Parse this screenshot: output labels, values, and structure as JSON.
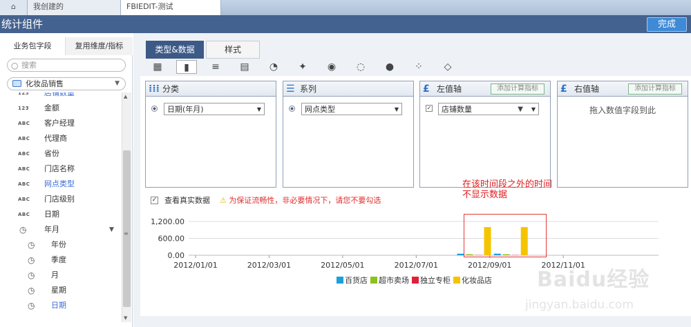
{
  "tabs": {
    "tab1": "我创建的",
    "tab2": "FBIEDIT-测试"
  },
  "title": "统计组件",
  "done_label": "完成",
  "left": {
    "tabs": [
      "业务包字段",
      "复用维度/指标"
    ],
    "search_placeholder": "搜索",
    "package": "化妆品销售",
    "fields": [
      {
        "type": "123",
        "name": "店铺数量",
        "highlight": true
      },
      {
        "type": "123",
        "name": "金额"
      },
      {
        "type": "ABC",
        "name": "客户经理"
      },
      {
        "type": "ABC",
        "name": "代理商"
      },
      {
        "type": "ABC",
        "name": "省份"
      },
      {
        "type": "ABC",
        "name": "门店名称"
      },
      {
        "type": "ABC",
        "name": "网点类型",
        "highlight": true
      },
      {
        "type": "ABC",
        "name": "门店级别"
      },
      {
        "type": "ABC",
        "name": "日期"
      },
      {
        "type": "clock",
        "name": "年月",
        "expanded": true
      },
      {
        "type": "clock",
        "name": "年份",
        "child": true
      },
      {
        "type": "clock",
        "name": "季度",
        "child": true
      },
      {
        "type": "clock",
        "name": "月",
        "child": true
      },
      {
        "type": "clock",
        "name": "星期",
        "child": true
      },
      {
        "type": "clock",
        "name": "日期",
        "child": true,
        "highlight": true
      }
    ]
  },
  "content_tabs": [
    "类型&数据",
    "样式"
  ],
  "chart_types": [
    "table-icon",
    "bar-chart-icon",
    "bar-horizontal-icon",
    "stacked-bar-icon",
    "pie-icon",
    "map-icon",
    "gauge-icon",
    "donut-icon",
    "bubble-icon",
    "scatter-icon",
    "radar-icon"
  ],
  "zones": {
    "category": {
      "title": "分类",
      "item": "日期(年月)"
    },
    "series": {
      "title": "系列",
      "item": "网点类型"
    },
    "left_axis": {
      "title": "左值轴",
      "button": "添加计算指标",
      "item": "店铺数量"
    },
    "right_axis": {
      "title": "右值轴",
      "button": "添加计算指标",
      "hint": "拖入数值字段到此"
    }
  },
  "annotation": {
    "line1": "在该时间段之外的时间",
    "line2": "不显示数据"
  },
  "real_data_label": "查看真实数据",
  "warning": "为保证流畅性，非必要情况下，请您不要勾选",
  "colors": {
    "百货店": "#1a9fe0",
    "超市卖场": "#8cc219",
    "独立专柜": "#e0203a",
    "化妆品店": "#f5c400"
  },
  "chart_data": {
    "type": "bar",
    "categories": [
      "2012/01/01",
      "2012/03/01",
      "2012/05/01",
      "2012/07/01",
      "2012/09/01",
      "2012/11/01"
    ],
    "ylim": [
      0,
      1200
    ],
    "yticks": [
      "0.00",
      "600.00",
      "1,200.00"
    ],
    "series": [
      {
        "name": "百货店",
        "color": "#1a9fe0",
        "points": [
          {
            "x": "2012/08",
            "y": 55
          },
          {
            "x": "2012/09",
            "y": 55
          }
        ]
      },
      {
        "name": "超市卖场",
        "color": "#8cc219",
        "points": [
          {
            "x": "2012/08",
            "y": 35
          },
          {
            "x": "2012/09",
            "y": 35
          }
        ]
      },
      {
        "name": "独立专柜",
        "color": "#e0203a",
        "points": [
          {
            "x": "2012/08",
            "y": 8
          },
          {
            "x": "2012/09",
            "y": 8
          }
        ]
      },
      {
        "name": "化妆品店",
        "color": "#f5c400",
        "points": [
          {
            "x": "2012/08",
            "y": 1000
          },
          {
            "x": "2012/09",
            "y": 1000
          }
        ]
      }
    ]
  },
  "watermark": {
    "text": "Baidu经验",
    "url": "jingyan.baidu.com"
  }
}
